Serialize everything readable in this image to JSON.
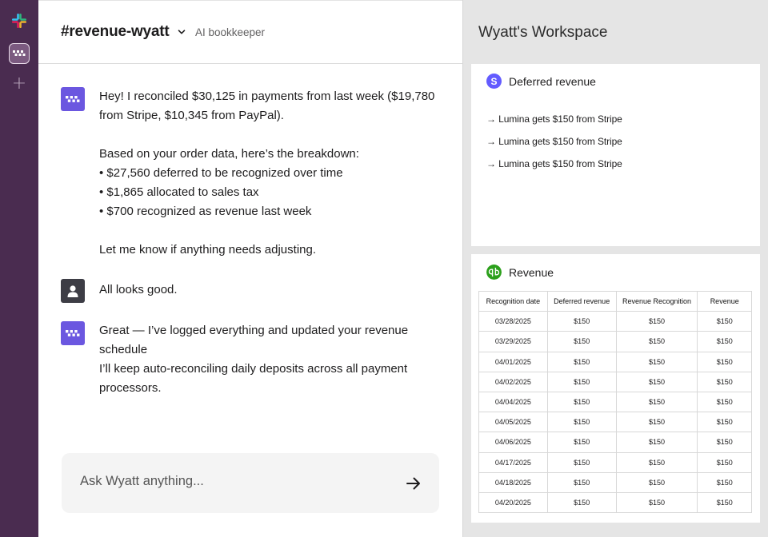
{
  "channel": {
    "name": "#revenue-wyatt",
    "description": "AI bookkeeper"
  },
  "messages": [
    {
      "sender": "bot",
      "lines": [
        "Hey! I reconciled $30,125 in payments from last week ($19,780",
        "from Stripe, $10,345 from PayPal).",
        "",
        "Based on your order data, here’s the breakdown:",
        "• $27,560 deferred to be recognized over time",
        "• $1,865 allocated to sales tax",
        "• $700 recognized as revenue last week",
        "",
        "Let me know if anything needs adjusting."
      ]
    },
    {
      "sender": "user",
      "lines": [
        "All looks good."
      ]
    },
    {
      "sender": "bot",
      "lines": [
        "Great — I’ve logged everything and updated your revenue",
        "schedule",
        "I’ll keep auto-reconciling daily deposits across all payment",
        "processors."
      ]
    }
  ],
  "composer": {
    "placeholder": "Ask Wyatt anything..."
  },
  "workspace": {
    "title": "Wyatt's Workspace",
    "deferred": {
      "title": "Deferred revenue",
      "items": [
        "→ Lumina gets $150 from Stripe",
        "→ Lumina gets $150 from Stripe",
        "→ Lumina gets $150 from Stripe"
      ]
    },
    "revenue": {
      "title": "Revenue",
      "columns": [
        "Recognition date",
        "Deferred revenue",
        "Revenue Recognition",
        "Revenue"
      ],
      "rows": [
        [
          "03/28/2025",
          "$150",
          "$150",
          "$150"
        ],
        [
          "03/29/2025",
          "$150",
          "$150",
          "$150"
        ],
        [
          "04/01/2025",
          "$150",
          "$150",
          "$150"
        ],
        [
          "04/02/2025",
          "$150",
          "$150",
          "$150"
        ],
        [
          "04/04/2025",
          "$150",
          "$150",
          "$150"
        ],
        [
          "04/05/2025",
          "$150",
          "$150",
          "$150"
        ],
        [
          "04/06/2025",
          "$150",
          "$150",
          "$150"
        ],
        [
          "04/17/2025",
          "$150",
          "$150",
          "$150"
        ],
        [
          "04/18/2025",
          "$150",
          "$150",
          "$150"
        ],
        [
          "04/20/2025",
          "$150",
          "$150",
          "$150"
        ]
      ]
    }
  },
  "colors": {
    "rail": "#4a2c50",
    "bot_avatar": "#6b57e0",
    "stripe": "#635bff",
    "quickbooks": "#2ca01c"
  },
  "icons": {
    "workspace_logo": "slack-logo-icon",
    "app": "wyatt-app-icon",
    "add": "plus-icon",
    "channel_menu": "chevron-down-icon",
    "send": "arrow-right-icon",
    "deferred_source": "stripe-icon",
    "revenue_source": "quickbooks-icon"
  }
}
